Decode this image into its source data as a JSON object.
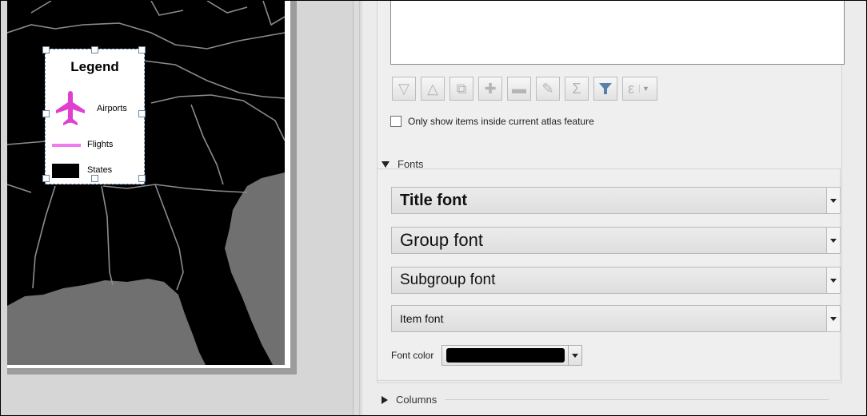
{
  "legend": {
    "title": "Legend",
    "items": [
      {
        "label": "Airports",
        "symbol": "airplane-icon",
        "color": "#e040d0"
      },
      {
        "label": "Flights",
        "symbol": "line-symbol",
        "color": "#f07af0"
      },
      {
        "label": "States",
        "symbol": "fill-symbol",
        "color": "#000000"
      }
    ]
  },
  "map": {
    "land_color": "#000000",
    "water_color": "#707070",
    "border_color": "#8c8c8c"
  },
  "toolbar": {
    "buttons": [
      "move-down-icon",
      "move-up-icon",
      "add-group-icon",
      "add-item-icon",
      "remove-item-icon",
      "edit-item-icon",
      "sum-icon",
      "filter-icon",
      "expression-icon"
    ]
  },
  "atlas_filter": {
    "label": "Only show items inside current atlas feature",
    "checked": false
  },
  "fonts": {
    "section_label": "Fonts",
    "title_font": "Title font",
    "group_font": "Group font",
    "subgroup_font": "Subgroup font",
    "item_font": "Item font",
    "font_color_label": "Font color",
    "font_color_value": "#000000"
  },
  "columns": {
    "section_label": "Columns"
  }
}
